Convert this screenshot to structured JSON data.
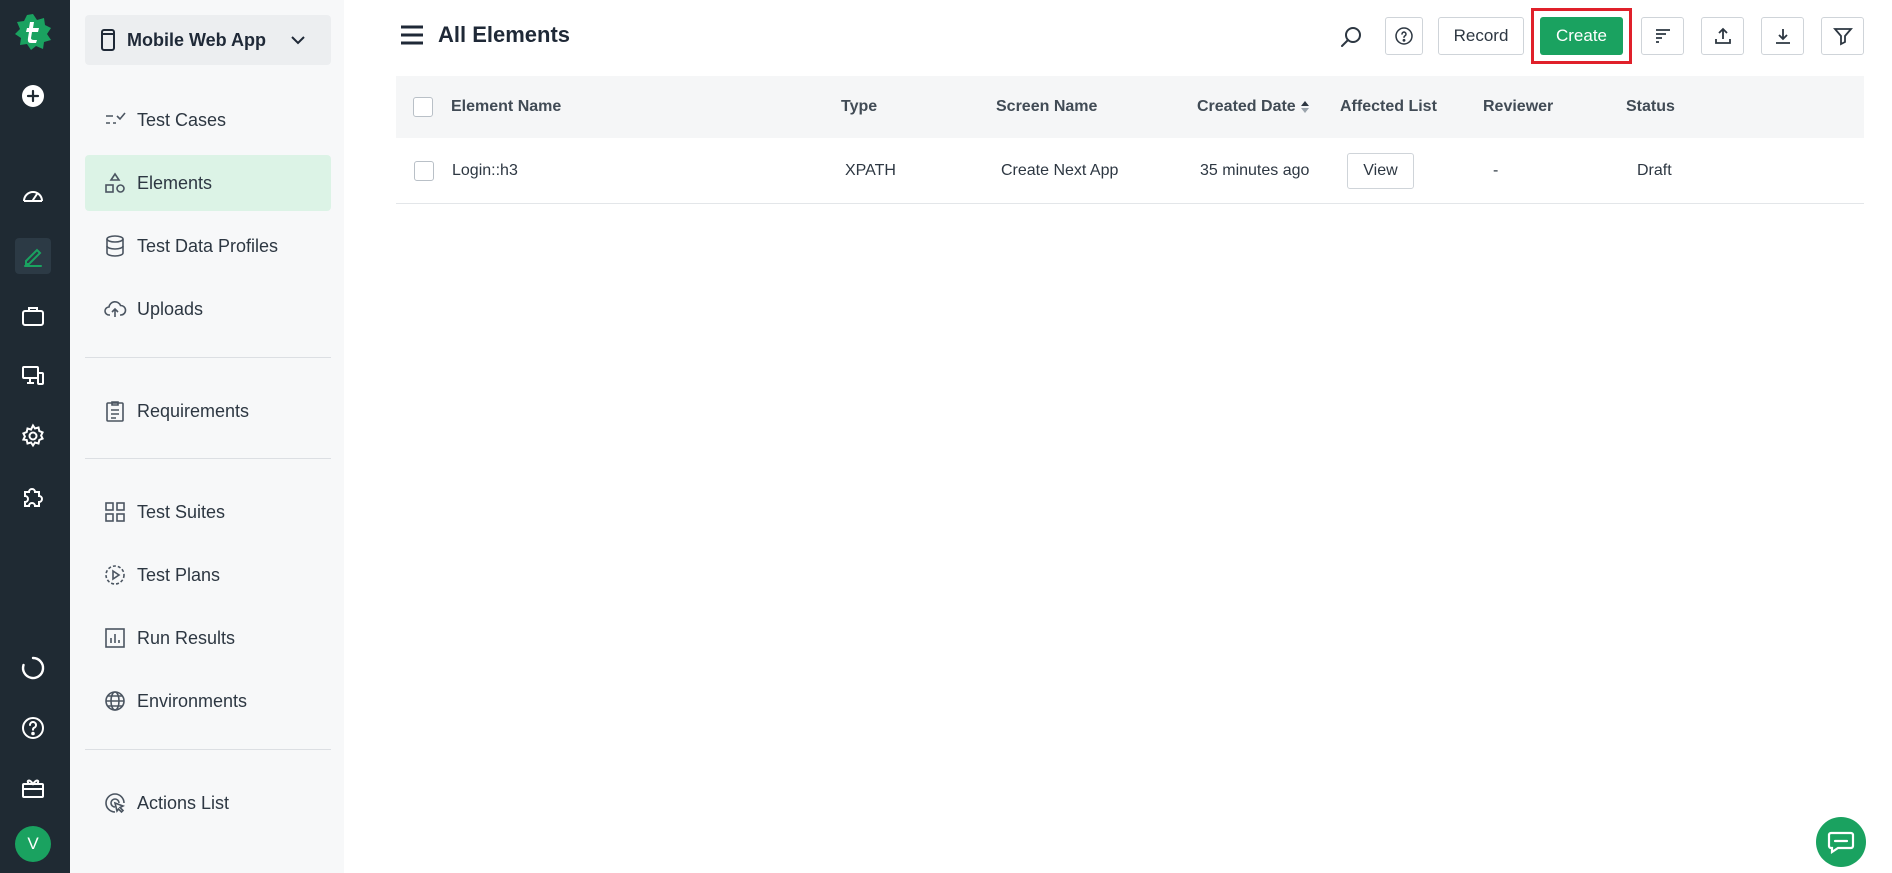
{
  "sidebar": {
    "project_name": "Mobile Web App",
    "items": [
      {
        "label": "Test Cases",
        "icon": "test-cases-icon"
      },
      {
        "label": "Elements",
        "icon": "elements-icon"
      },
      {
        "label": "Test Data Profiles",
        "icon": "database-icon"
      },
      {
        "label": "Uploads",
        "icon": "cloud-upload-icon"
      },
      {
        "label": "Requirements",
        "icon": "clipboard-icon"
      },
      {
        "label": "Test Suites",
        "icon": "grid-icon"
      },
      {
        "label": "Test Plans",
        "icon": "play-circle-icon"
      },
      {
        "label": "Run Results",
        "icon": "bar-chart-icon"
      },
      {
        "label": "Environments",
        "icon": "globe-icon"
      },
      {
        "label": "Actions List",
        "icon": "cursor-click-icon"
      }
    ],
    "active": "Elements"
  },
  "user": {
    "avatar_letter": "V"
  },
  "header": {
    "title": "All Elements",
    "record_label": "Record",
    "create_label": "Create"
  },
  "table": {
    "columns": [
      "Element Name",
      "Type",
      "Screen Name",
      "Created Date",
      "Affected List",
      "Reviewer",
      "Status"
    ],
    "rows": [
      {
        "element_name": "Login::h3",
        "type": "XPATH",
        "screen_name": "Create Next App",
        "created_date": "35 minutes ago",
        "affected_list": "View",
        "reviewer": "-",
        "status": "Draft"
      }
    ]
  },
  "colors": {
    "accent": "#1aa260",
    "rail_bg": "#1f2a33",
    "highlight": "#e0202a",
    "active_nav": "#dcf3e6"
  }
}
